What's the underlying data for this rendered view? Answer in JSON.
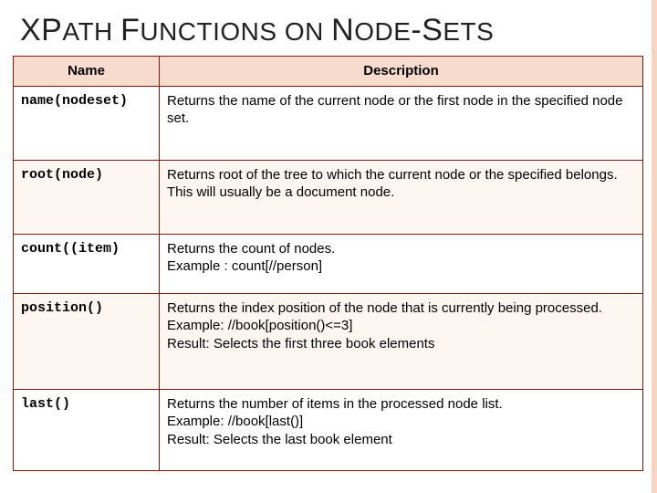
{
  "heading_html": "<span class='big'>XP</span>ATH <span class='big'>F</span>UNCTIONS ON <span class='big'>N</span>ODE<span class='big'>-S</span>ETS",
  "columns": {
    "name": "Name",
    "description": "Description"
  },
  "rows": [
    {
      "fn": "name(nodeset)",
      "desc": "Returns the name of the current node or the first node in the specified node set."
    },
    {
      "fn": "root(node)",
      "desc": "Returns root of the tree to which the current node or the specified belongs. This will usually be a document node."
    },
    {
      "fn": "count((item)",
      "desc": "Returns the count of nodes.\nExample : count[//person]"
    },
    {
      "fn": "position()",
      "desc": "Returns the index position of the node that is currently being processed.\nExample: //book[position()<=3]\nResult: Selects the first three book elements"
    },
    {
      "fn": "last()",
      "desc": "Returns the number of items in the processed node list.\nExample: //book[last()]\nResult: Selects the last book element"
    }
  ]
}
